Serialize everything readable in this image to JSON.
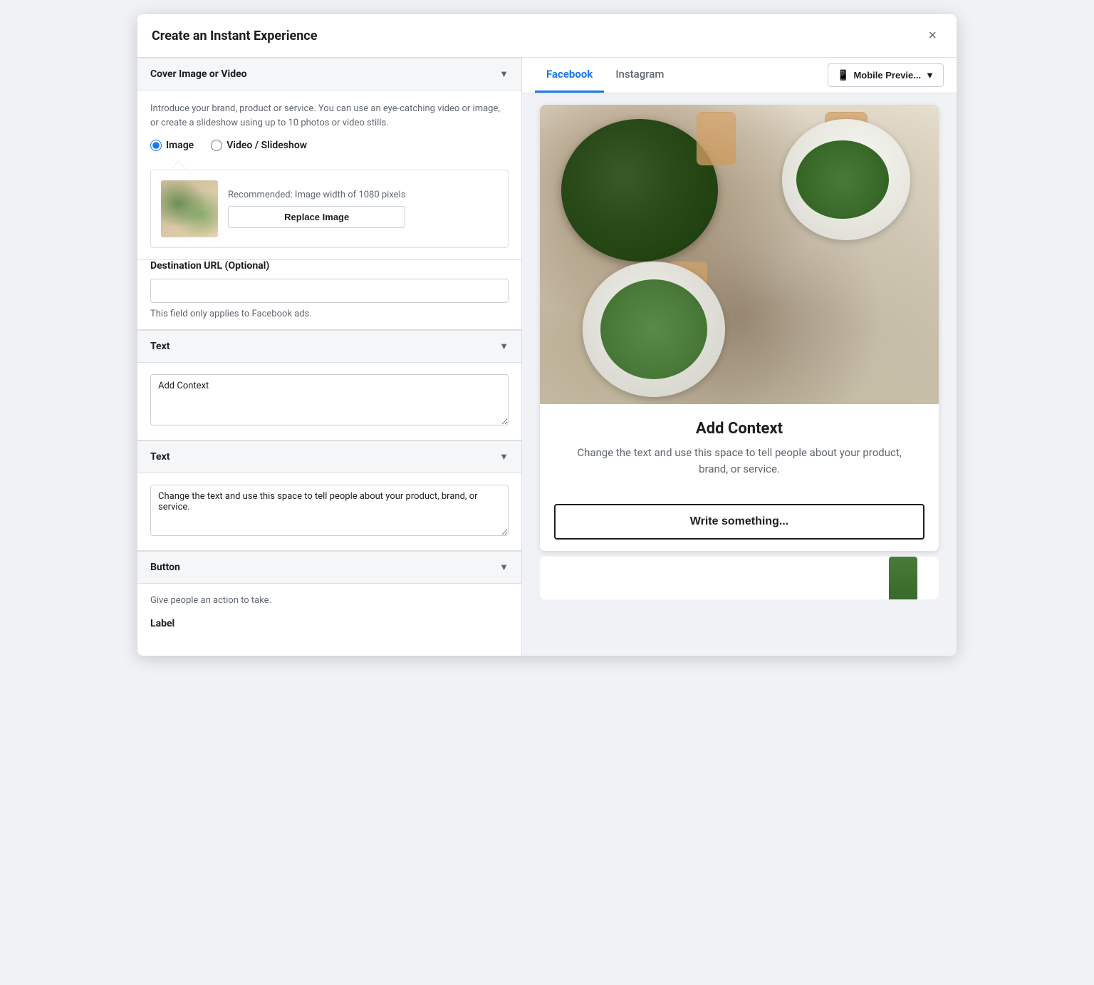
{
  "modal": {
    "title": "Create an Instant Experience",
    "close_label": "×"
  },
  "left_panel": {
    "cover_section": {
      "title": "Cover Image or Video",
      "description": "Introduce your brand, product or service. You can use an eye-catching video or image, or create a slideshow using up to 10 photos or video stills.",
      "radio_options": [
        {
          "id": "image",
          "label": "Image",
          "checked": true
        },
        {
          "id": "video_slideshow",
          "label": "Video / Slideshow",
          "checked": false
        }
      ],
      "image_rec_text": "Recommended: Image width of 1080 pixels",
      "replace_btn_label": "Replace Image"
    },
    "destination_url": {
      "label": "Destination URL (Optional)",
      "placeholder": "",
      "helper_text": "This field only applies to Facebook ads."
    },
    "text_section_1": {
      "title": "Text",
      "textarea_placeholder": "Add Context",
      "textarea_value": "Add Context"
    },
    "text_section_2": {
      "title": "Text",
      "textarea_value": "Change the text and use this space to tell people about your product, brand, or service."
    },
    "button_section": {
      "title": "Button",
      "description": "Give people an action to take.",
      "label_text": "Label"
    }
  },
  "right_panel": {
    "tabs": [
      {
        "id": "facebook",
        "label": "Facebook",
        "active": true
      },
      {
        "id": "instagram",
        "label": "Instagram",
        "active": false
      }
    ],
    "preview_button": {
      "label": "Mobile Previe...",
      "icon": "📱"
    },
    "preview": {
      "context_title": "Add Context",
      "context_description": "Change the text and use this space to tell people about your product, brand, or service.",
      "cta_button_label": "Write something..."
    }
  }
}
